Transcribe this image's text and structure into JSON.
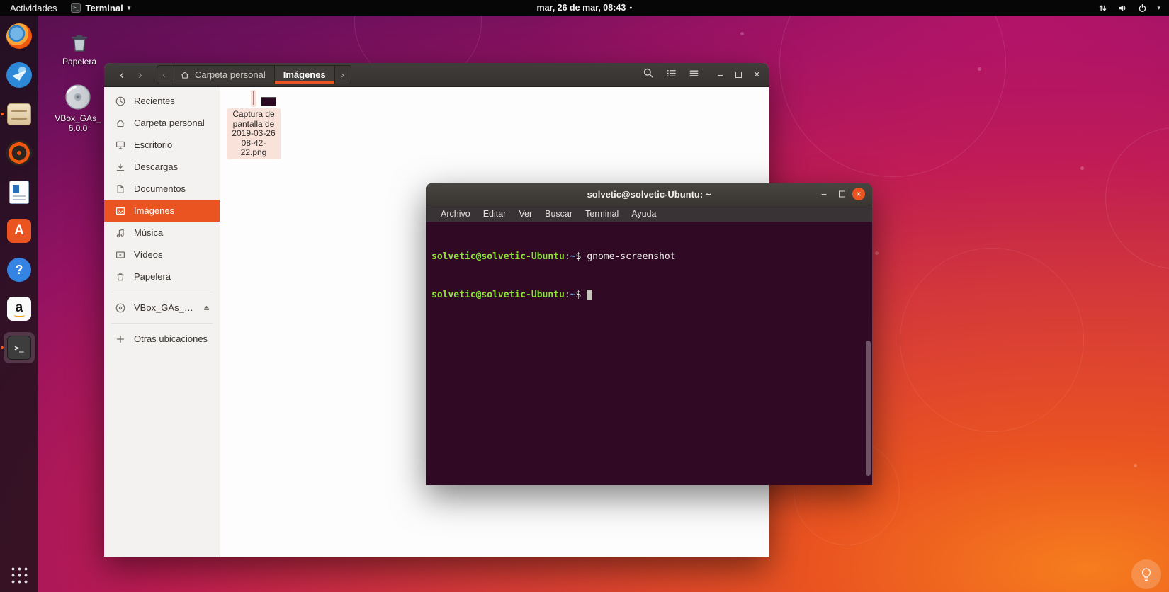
{
  "topbar": {
    "activities": "Actividades",
    "app_menu": {
      "label": "Terminal",
      "caret": "▾"
    },
    "clock": "mar, 26 de mar, 08:43",
    "notification_dot": "●",
    "status_caret": "▾"
  },
  "dock": {
    "items": [
      {
        "name": "firefox"
      },
      {
        "name": "thunderbird"
      },
      {
        "name": "files"
      },
      {
        "name": "rhythmbox"
      },
      {
        "name": "libreoffice-writer"
      },
      {
        "name": "ubuntu-software",
        "glyph": "A"
      },
      {
        "name": "help",
        "glyph": "?"
      },
      {
        "name": "amazon",
        "glyph": "a"
      },
      {
        "name": "terminal",
        "glyph": ">_",
        "active": true
      }
    ]
  },
  "desktop": {
    "trash_label": "Papelera",
    "vbox_line1": "VBox_GAs_",
    "vbox_line2": "6.0.0"
  },
  "files_window": {
    "nav_back": "‹",
    "nav_forward": "›",
    "path_prev": "‹",
    "path_next": "›",
    "path_parent": "Carpeta personal",
    "path_current": "Imágenes",
    "minimize": "−",
    "close": "×",
    "sidebar": [
      {
        "label": "Recientes"
      },
      {
        "label": "Carpeta personal"
      },
      {
        "label": "Escritorio"
      },
      {
        "label": "Descargas"
      },
      {
        "label": "Documentos"
      },
      {
        "label": "Imágenes",
        "selected": true
      },
      {
        "label": "Música"
      },
      {
        "label": "Vídeos"
      },
      {
        "label": "Papelera"
      },
      {
        "label": "VBox_GAs_…"
      },
      {
        "label": "Otras ubicaciones"
      }
    ],
    "file_name": "Captura de pantalla de 2019-03-26 08-42-22.png"
  },
  "terminal": {
    "title": "solvetic@solvetic-Ubuntu: ~",
    "minimize": "−",
    "close": "×",
    "menu": [
      "Archivo",
      "Editar",
      "Ver",
      "Buscar",
      "Terminal",
      "Ayuda"
    ],
    "prompt_user_host": "solvetic@solvetic-Ubuntu",
    "prompt_colon": ":",
    "prompt_path": "~",
    "prompt_symbol": "$",
    "command": "gnome-screenshot"
  },
  "colors": {
    "accent": "#E95420",
    "terminal_background": "#300A24",
    "prompt_green": "#8AE234",
    "prompt_path_blue": "#729FCF"
  }
}
